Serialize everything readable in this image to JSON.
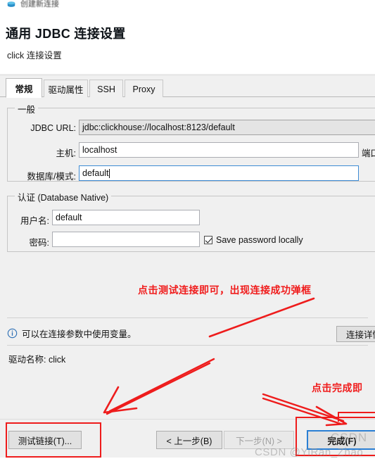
{
  "window": {
    "title": "创建新连接",
    "icon": "database-connection-icon"
  },
  "header": {
    "title": "通用 JDBC 连接设置",
    "subtitle": "click 连接设置"
  },
  "tabs": [
    {
      "label": "常规",
      "active": true
    },
    {
      "label": "驱动属性",
      "active": false
    },
    {
      "label": "SSH",
      "active": false
    },
    {
      "label": "Proxy",
      "active": false
    }
  ],
  "general_group": {
    "legend": "一般",
    "jdbc_url": {
      "label": "JDBC URL:",
      "value": "jdbc:clickhouse://localhost:8123/default",
      "readonly": true
    },
    "host": {
      "label": "主机:",
      "value": "localhost"
    },
    "port": {
      "label": "端口"
    },
    "database": {
      "label": "数据库/模式:",
      "value": "default",
      "focused": true
    }
  },
  "auth_group": {
    "legend": "认证 (Database Native)",
    "username": {
      "label": "用户名:",
      "value": "default"
    },
    "password": {
      "label": "密码:",
      "value": ""
    },
    "save_password": {
      "label": "Save password locally",
      "checked": true
    }
  },
  "info": {
    "icon": "info-circle-icon",
    "text": "可以在连接参数中使用变量。",
    "details_button": "连接详情"
  },
  "driver": {
    "text": "驱动名称: click"
  },
  "footer": {
    "test_connection": "测试链接(T)...",
    "back": "< 上一步(B)",
    "next": "下一步(N) >",
    "finish": "完成(F)"
  },
  "annotations": {
    "note_test": "点击测试连接即可，出现连接成功弹框",
    "note_finish": "点击完成即",
    "watermark": "CSDN @YiRan_Zhao",
    "watermark_mark": "CSDN",
    "red_color": "#ee1c1c"
  }
}
